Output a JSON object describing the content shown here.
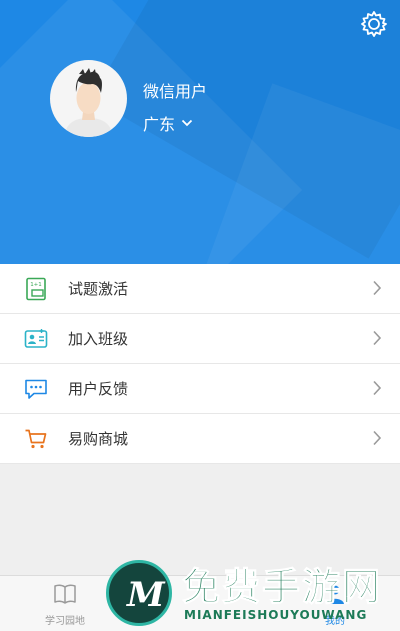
{
  "profile": {
    "nickname": "微信用户",
    "region": "广东"
  },
  "menu": [
    {
      "label": "试题激活",
      "icon": "activation-card-icon",
      "color": "#3aa857"
    },
    {
      "label": "加入班级",
      "icon": "id-card-icon",
      "color": "#2bb3c8"
    },
    {
      "label": "用户反馈",
      "icon": "chat-bubble-icon",
      "color": "#1e88e5"
    },
    {
      "label": "易购商城",
      "icon": "shopping-cart-icon",
      "color": "#e8741e"
    }
  ],
  "tabbar": [
    {
      "label": "学习园地",
      "icon": "book-icon",
      "active": false
    },
    {
      "label": "",
      "icon": "",
      "active": false
    },
    {
      "label": "",
      "icon": "",
      "active": false
    },
    {
      "label": "我的",
      "icon": "person-icon",
      "active": true
    }
  ],
  "watermark": {
    "cn": "免费手游网",
    "en": "MIANFEISHOUYOUWANG"
  },
  "colors": {
    "header_bg": "#1e88e5",
    "accent": "#1e88e5"
  }
}
